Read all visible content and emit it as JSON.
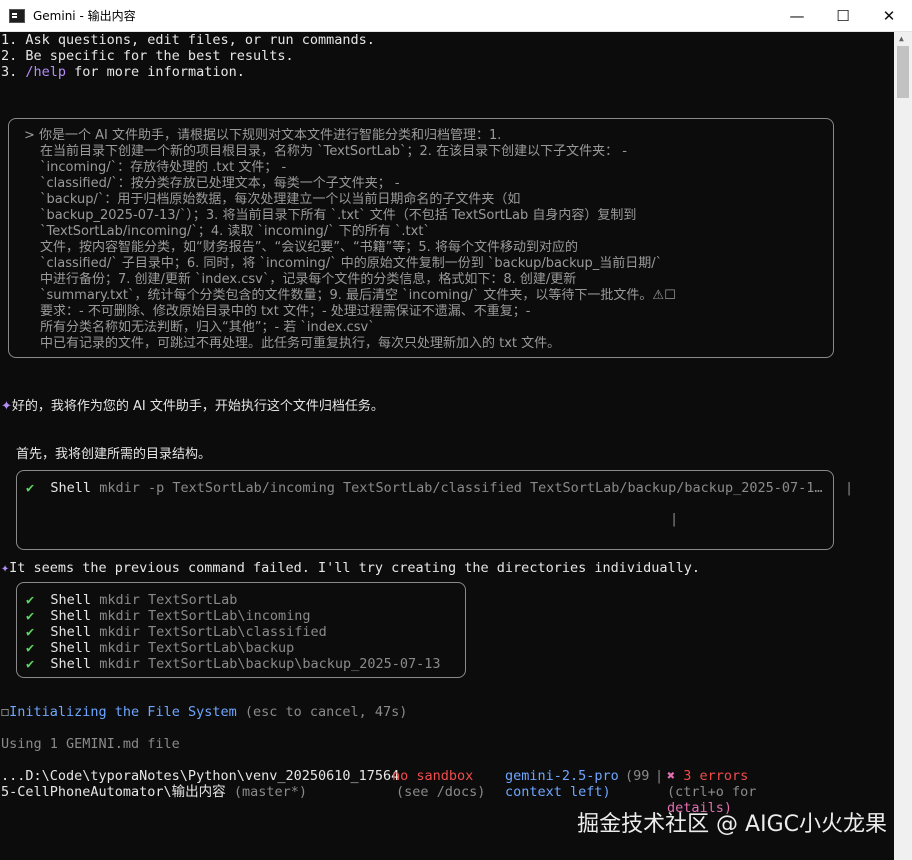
{
  "window": {
    "title": "Gemini - 输出内容",
    "minimize": "—",
    "maximize": "☐",
    "close": "✕"
  },
  "intro": [
    "1. Ask questions, edit files, or run commands.",
    "2. Be specific for the best results.",
    "3. /help for more information."
  ],
  "intro_help_cmd": "/help",
  "prompt_lines": [
    "> 你是一个 AI 文件助手，请根据以下规则对文本文件进行智能分类和归档管理：1.",
    "在当前目录下创建一个新的项目根目录，名称为 `TextSortLab`；2. 在该目录下创建以下子文件夹：   -",
    "`incoming/`：存放待处理的 .txt 文件；     -",
    "`classified/`：按分类存放已处理文本，每类一个子文件夹；     -",
    "`backup/`：用于归档原始数据，每次处理建立一个以当前日期命名的子文件夹（如",
    "`backup_2025-07-13/`）；3. 将当前目录下所有 `.txt` 文件（不包括 TextSortLab 自身内容）复制到",
    "`TextSortLab/incoming/`；4. 读取 `incoming/` 下的所有 `.txt`",
    "文件，按内容智能分类，如“财务报告”、“会议纪要”、“书籍”等；5. 将每个文件移动到对应的",
    "`classified/` 子目录中；6. 同时，将 `incoming/` 中的原始文件复制一份到 `backup/backup_当前日期/`",
    "中进行备份；7. 创建/更新 `index.csv`，记录每个文件的分类信息，格式如下：8. 创建/更新",
    "`summary.txt`，统计每个分类包含的文件数量；9. 最后清空 `incoming/` 文件夹，以等待下一批文件。⚠☐",
    "要求：- 不可删除、修改原始目录中的 txt 文件；- 处理过程需保证不遗漏、不重复；-",
    "所有分类名称如无法判断，归入“其他”；- 若 `index.csv`",
    "中已有记录的文件，可跳过不再处理。此任务可重复执行，每次只处理新加入的 txt 文件。"
  ],
  "reply1": "好的，我将作为您的 AI 文件助手，开始执行这个文件归档任务。",
  "reply1_marker": "✦",
  "step1": "首先，我将创建所需的目录结构。",
  "shell_label": "Shell",
  "check": "✔",
  "shell_cmd_1": "mkdir -p TextSortLab/incoming TextSortLab/classified TextSortLab/backup/backup_2025-07-1…",
  "reply2": "It seems the previous command failed. I'll try creating the directories individually.",
  "reply2_marker": "✦",
  "shell_cmds": [
    "mkdir TextSortLab",
    "mkdir TextSortLab\\incoming",
    "mkdir TextSortLab\\classified",
    "mkdir TextSortLab\\backup",
    "mkdir TextSortLab\\backup\\backup_2025-07-13"
  ],
  "status": {
    "spinner": "☐",
    "text": "Initializing the File System",
    "hint": "(esc to cancel, 47s)"
  },
  "context_file": "Using 1 GEMINI.md file",
  "footer": {
    "path_line1": "...D:\\Code\\typoraNotes\\Python\\venv_20250610_17564",
    "path_line2": "5-CellPhoneAutomator\\输出内容",
    "branch": "(master*)",
    "sandbox": "no sandbox",
    "sandbox_hint": "(see /docs)",
    "model": "gemini-2.5-pro",
    "context_pct": "(99",
    "context_label": "context left)",
    "errors_icon": "✖",
    "errors": "3 errors",
    "errors_hint1": "(ctrl+o for",
    "errors_hint2": "details)"
  },
  "watermark": "掘金技术社区 @ AIGC小火龙果"
}
